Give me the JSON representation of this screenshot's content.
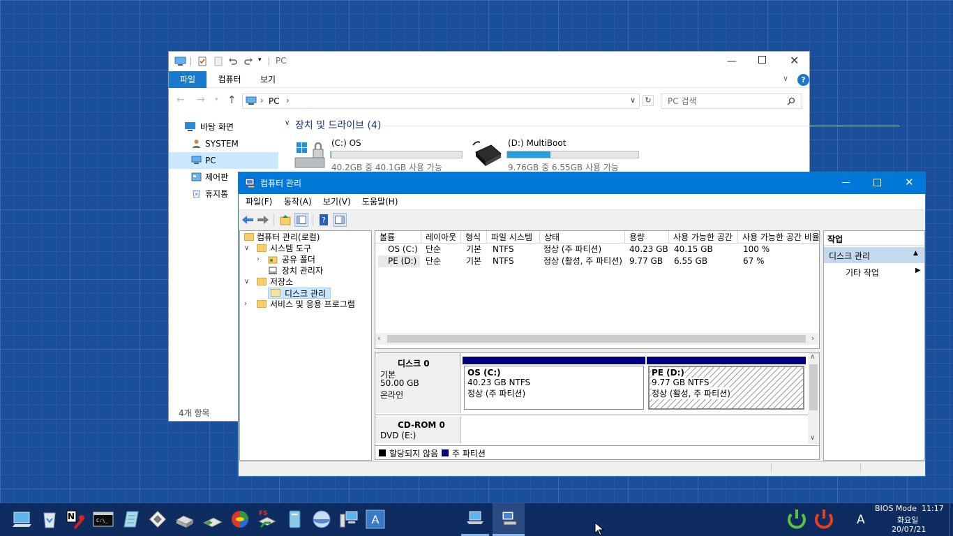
{
  "explorer": {
    "title": "PC",
    "ribbon_tabs": [
      "파일",
      "컴퓨터",
      "보기"
    ],
    "address": "PC",
    "search_placeholder": "PC 검색",
    "nav_items": [
      "바탕 화면",
      "SYSTEM",
      "PC",
      "제어판",
      "휴지통"
    ],
    "section_title": "장치 및 드라이브 (4)",
    "drives": [
      {
        "name": "(C:) OS",
        "usage": "40.2GB 중 40.1GB 사용 가능",
        "used_fraction": 0.003
      },
      {
        "name": "(D:) MultiBoot",
        "usage": "9.76GB 중 6.55GB 사용 가능",
        "used_fraction": 0.33
      }
    ],
    "status": "4개 항목"
  },
  "cm": {
    "title": "컴퓨터 관리",
    "menu": [
      "파일(F)",
      "동작(A)",
      "보기(V)",
      "도움말(H)"
    ],
    "tree": {
      "root": "컴퓨터 관리(로컬)",
      "system_tools": "시스템 도구",
      "shared_folders": "공유 폴더",
      "device_manager": "장치 관리자",
      "storage": "저장소",
      "disk_mgmt": "디스크 관리",
      "services": "서비스 및 응용 프로그램"
    },
    "columns": [
      "볼륨",
      "레이아웃",
      "형식",
      "파일 시스템",
      "상태",
      "용량",
      "사용 가능한 공간",
      "사용 가능한 공간 비율"
    ],
    "rows": [
      [
        "OS (C:)",
        "단순",
        "기본",
        "NTFS",
        "정상 (주 파티션)",
        "40.23 GB",
        "40.15 GB",
        "100 %"
      ],
      [
        "PE (D:)",
        "단순",
        "기본",
        "NTFS",
        "정상 (활성, 주 파티션)",
        "9.77 GB",
        "6.55 GB",
        "67 %"
      ]
    ],
    "disks": [
      {
        "name": "디스크 0",
        "type": "기본",
        "size": "50.00 GB",
        "state": "온라인",
        "partitions": [
          {
            "title": "OS  (C:)",
            "fs": "40.23 GB NTFS",
            "status": "정상 (주 파티션)"
          },
          {
            "title": "PE  (D:)",
            "fs": "9.77 GB NTFS",
            "status": "정상 (활성, 주 파티션)"
          }
        ]
      },
      {
        "name": "CD-ROM 0",
        "type": "DVD (E:)"
      }
    ],
    "legend": [
      "할당되지 않음",
      "주 파티션"
    ],
    "actions": {
      "header": "작업",
      "section": "디스크 관리",
      "item": "기타 작업"
    }
  },
  "taskbar": {
    "bios": "BIOS Mode",
    "time": "11:17",
    "day": "화요일",
    "date": "20/07/21",
    "ime": "A"
  },
  "colors": {
    "accent": "#0078d7",
    "partition": "#000080",
    "desktop": "#1a4f9c"
  }
}
